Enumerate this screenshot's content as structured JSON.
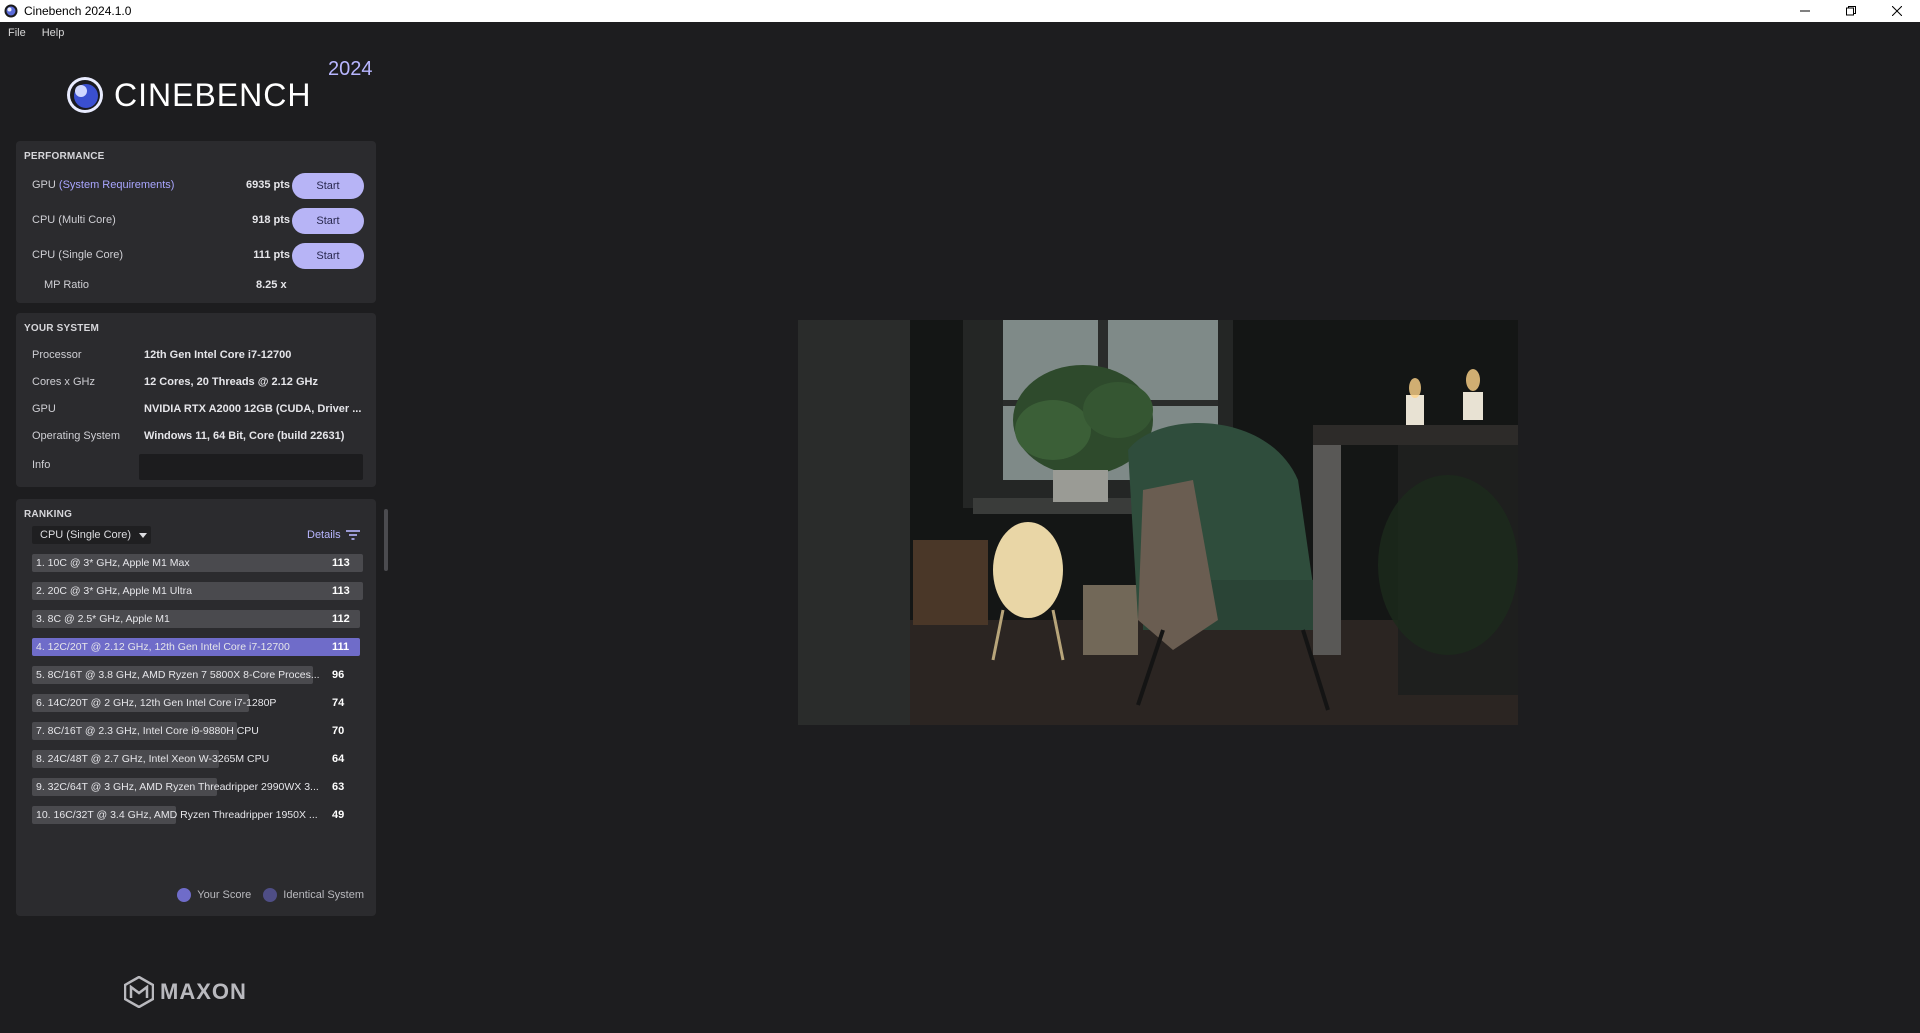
{
  "window": {
    "title": "Cinebench 2024.1.0",
    "controls": [
      "minimize-icon",
      "restore-icon",
      "close-icon"
    ]
  },
  "menu": {
    "file": "File",
    "help": "Help"
  },
  "logo": {
    "text": "CINEBENCH",
    "year": "2024"
  },
  "performance": {
    "title": "PERFORMANCE",
    "rows": [
      {
        "label": "GPU ",
        "label_accent": "(System Requirements)",
        "score": "6935 pts",
        "button": "Start"
      },
      {
        "label": "CPU (Multi Core)",
        "score": "918 pts",
        "button": "Start"
      },
      {
        "label": "CPU (Single Core)",
        "score": "111 pts",
        "button": "Start"
      }
    ],
    "mp_ratio": {
      "label": "MP Ratio",
      "value": "8.25 x"
    }
  },
  "system": {
    "title": "YOUR SYSTEM",
    "rows": [
      {
        "label": "Processor",
        "value": "12th Gen Intel Core i7-12700"
      },
      {
        "label": "Cores x GHz",
        "value": "12 Cores, 20 Threads @ 2.12 GHz"
      },
      {
        "label": "GPU",
        "value": "NVIDIA RTX A2000 12GB (CUDA, Driver ..."
      },
      {
        "label": "Operating System",
        "value": "Windows 11, 64 Bit, Core (build 22631)"
      },
      {
        "label": "Info",
        "value": ""
      }
    ]
  },
  "ranking": {
    "title": "RANKING",
    "selected": "CPU (Single Core)",
    "details": "Details",
    "max_score": 113,
    "rows": [
      {
        "name": "1. 10C @ 3* GHz, Apple M1 Max",
        "score": 113,
        "you": false
      },
      {
        "name": "2. 20C @ 3* GHz, Apple M1 Ultra",
        "score": 113,
        "you": false
      },
      {
        "name": "3. 8C @ 2.5* GHz, Apple M1",
        "score": 112,
        "you": false
      },
      {
        "name": "4. 12C/20T @ 2.12 GHz, 12th Gen Intel Core i7-12700",
        "score": 111,
        "you": true
      },
      {
        "name": "5. 8C/16T @ 3.8 GHz, AMD Ryzen 7 5800X 8-Core Proces...",
        "score": 96,
        "you": false
      },
      {
        "name": "6. 14C/20T @ 2 GHz, 12th Gen Intel Core i7-1280P",
        "score": 74,
        "you": false
      },
      {
        "name": "7. 8C/16T @ 2.3 GHz, Intel Core i9-9880H CPU",
        "score": 70,
        "you": false
      },
      {
        "name": "8. 24C/48T @ 2.7 GHz, Intel Xeon W-3265M CPU",
        "score": 64,
        "you": false
      },
      {
        "name": "9. 32C/64T @ 3 GHz, AMD Ryzen Threadripper 2990WX 3...",
        "score": 63,
        "you": false
      },
      {
        "name": "10. 16C/32T @ 3.4 GHz, AMD Ryzen Threadripper 1950X ...",
        "score": 49,
        "you": false
      }
    ],
    "legend": {
      "your_score": "Your Score",
      "identical": "Identical System"
    }
  },
  "footer": {
    "brand": "MAXON"
  },
  "colors": {
    "accent": "#b7b4f6",
    "your_score": "#6f6cc9",
    "identical": "#4f4e86",
    "bar": "#4a4a4e"
  }
}
